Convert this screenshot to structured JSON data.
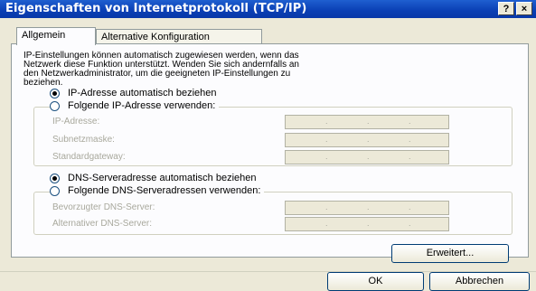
{
  "window": {
    "title": "Eigenschaften von Internetprotokoll (TCP/IP)",
    "help_label": "?",
    "close_label": "×"
  },
  "tabs": [
    {
      "label": "Allgemein",
      "active": true
    },
    {
      "label": "Alternative Konfiguration",
      "active": false
    }
  ],
  "intro_lines": [
    "IP-Einstellungen können automatisch zugewiesen werden, wenn das",
    "Netzwerk diese Funktion unterstützt. Wenden Sie sich andernfalls an",
    "den Netzwerkadministrator, um die geeigneten IP-Einstellungen zu",
    "beziehen."
  ],
  "ip": {
    "auto_label": "IP-Adresse automatisch beziehen",
    "auto_selected": true,
    "manual_label": "Folgende IP-Adresse verwenden:",
    "manual_selected": false,
    "fields": [
      {
        "label": "IP-Adresse:"
      },
      {
        "label": "Subnetzmaske:"
      },
      {
        "label": "Standardgateway:"
      }
    ]
  },
  "dns": {
    "auto_label": "DNS-Serveradresse automatisch beziehen",
    "auto_selected": true,
    "manual_label": "Folgende DNS-Serveradressen verwenden:",
    "manual_selected": false,
    "fields": [
      {
        "label": "Bevorzugter DNS-Server:"
      },
      {
        "label": "Alternativer DNS-Server:"
      }
    ]
  },
  "ip_separator": ".",
  "buttons": {
    "advanced": "Erweitert...",
    "ok": "OK",
    "cancel": "Abbrechen"
  }
}
